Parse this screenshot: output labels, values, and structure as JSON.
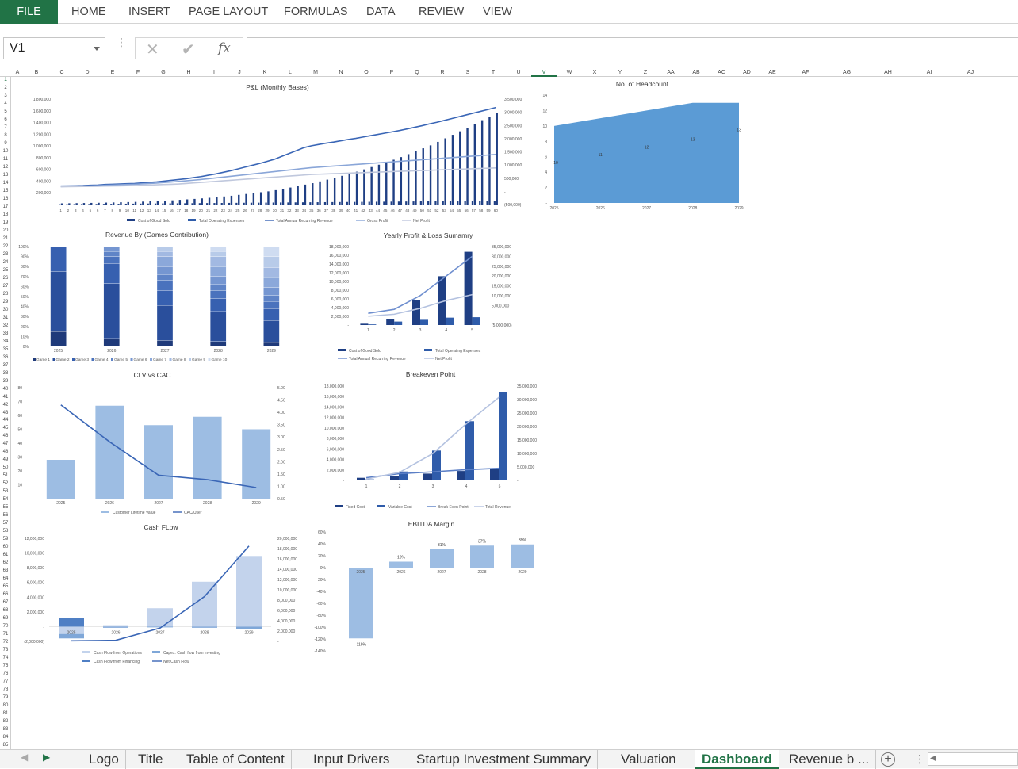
{
  "ribbon": {
    "file": "FILE",
    "tabs": [
      "HOME",
      "INSERT",
      "PAGE LAYOUT",
      "FORMULAS",
      "DATA",
      "REVIEW",
      "VIEW"
    ]
  },
  "formula_bar": {
    "name_box": "V1",
    "formula": "",
    "fx": "fx",
    "cancel": "✕",
    "enter": "✔"
  },
  "columns": [
    "A",
    "B",
    "C",
    "D",
    "E",
    "F",
    "G",
    "H",
    "I",
    "J",
    "K",
    "L",
    "M",
    "N",
    "O",
    "P",
    "Q",
    "R",
    "S",
    "T",
    "U",
    "V",
    "W",
    "X",
    "Y",
    "Z",
    "AA",
    "AB",
    "AC",
    "AD",
    "AE",
    "AF",
    "AG",
    "AH",
    "AI",
    "AJ"
  ],
  "selected_column": "V",
  "rows": [
    1,
    2,
    3,
    4,
    5,
    6,
    7,
    8,
    9,
    10,
    11,
    12,
    13,
    14,
    15,
    16,
    17,
    18,
    19,
    20,
    21,
    22,
    23,
    24,
    25,
    26,
    27,
    28,
    29,
    30,
    31,
    32,
    33,
    34,
    35,
    36,
    37,
    38,
    39,
    40,
    41,
    42,
    43,
    44,
    45,
    46,
    47,
    48,
    49,
    50,
    51,
    52,
    53,
    54,
    55,
    56,
    57,
    58,
    59,
    60,
    61,
    62,
    63,
    64,
    65,
    66,
    67,
    68,
    69,
    70,
    71,
    72,
    73,
    74,
    75,
    76,
    77,
    78,
    79,
    80,
    81,
    82,
    83,
    84,
    85
  ],
  "sheet_tabs": [
    "Logo",
    "Title",
    "Table of Content",
    "Input Drivers",
    "Startup Investment Summary",
    "Valuation",
    "Dashboard",
    "Revenue b ..."
  ],
  "active_sheet": "Dashboard",
  "colors": {
    "excel_green": "#217346",
    "navy": "#1f3f84",
    "mid_blue": "#2f5caa",
    "light_blue": "#9dbde3",
    "pale_blue": "#c3d3ec",
    "area_blue": "#5b9bd5"
  },
  "chart_data": [
    {
      "id": "pnl",
      "type": "bar",
      "title": "P&L (Monthly Bases)",
      "x": [
        1,
        2,
        3,
        4,
        5,
        6,
        7,
        8,
        9,
        10,
        11,
        12,
        13,
        14,
        15,
        16,
        17,
        18,
        19,
        20,
        21,
        22,
        23,
        24,
        25,
        26,
        27,
        28,
        29,
        30,
        31,
        32,
        33,
        34,
        35,
        36,
        37,
        38,
        39,
        40,
        41,
        42,
        43,
        44,
        45,
        46,
        47,
        48,
        49,
        50,
        51,
        52,
        53,
        54,
        55,
        56,
        57,
        58,
        59,
        60
      ],
      "y_left_ticks": [
        "-",
        "200,000",
        "400,000",
        "600,000",
        "800,000",
        "1,000,000",
        "1,200,000",
        "1,400,000",
        "1,600,000",
        "1,800,000"
      ],
      "y_right_ticks": [
        "(500,000)",
        "-",
        "500,000",
        "1,000,000",
        "1,500,000",
        "2,000,000",
        "2,500,000",
        "3,000,000",
        "3,500,000"
      ],
      "ylim_left": [
        0,
        1800000
      ],
      "ylim_right": [
        -500000,
        3500000
      ],
      "series": [
        {
          "name": "Cost of Good Sold",
          "type": "bar",
          "axis": "left",
          "values": [
            5000,
            6000,
            7000,
            8000,
            9000,
            10000,
            11000,
            12000,
            13000,
            14000,
            15000,
            16000,
            17000,
            18000,
            19000,
            20000,
            21000,
            22000,
            23000,
            24000,
            25000,
            26000,
            27000,
            28000,
            29000,
            30000,
            31000,
            32000,
            33000,
            34000,
            35000,
            36000,
            37000,
            38000,
            39000,
            40000,
            41000,
            42000,
            43000,
            44000,
            45000,
            46000,
            47000,
            48000,
            49000,
            50000,
            51000,
            52000,
            53000,
            54000,
            55000,
            56000,
            57000,
            58000,
            59000,
            60000,
            61000,
            62000,
            63000,
            64000
          ]
        },
        {
          "name": "Total Operating Expenses",
          "type": "bar",
          "axis": "left",
          "values": [
            20000,
            22000,
            24000,
            26000,
            28000,
            30000,
            33000,
            36000,
            39000,
            42000,
            45000,
            50000,
            55000,
            60000,
            66000,
            72000,
            80000,
            88000,
            96000,
            105000,
            115000,
            126000,
            138000,
            150000,
            165000,
            180000,
            195000,
            210000,
            225000,
            245000,
            265000,
            290000,
            315000,
            340000,
            365000,
            395000,
            425000,
            455000,
            490000,
            525000,
            560000,
            600000,
            640000,
            680000,
            720000,
            765000,
            810000,
            860000,
            910000,
            960000,
            1010000,
            1070000,
            1130000,
            1190000,
            1250000,
            1310000,
            1380000,
            1440000,
            1500000,
            1560000
          ]
        },
        {
          "name": "Total Annual Recurring Revenue",
          "type": "line",
          "axis": "right",
          "values": [
            200000,
            205000,
            210000,
            215000,
            230000,
            240000,
            260000,
            270000,
            280000,
            290000,
            300000,
            320000,
            340000,
            360000,
            390000,
            420000,
            450000,
            480000,
            520000,
            560000,
            610000,
            660000,
            720000,
            780000,
            850000,
            920000,
            990000,
            1060000,
            1140000,
            1220000,
            1330000,
            1440000,
            1550000,
            1660000,
            1730000,
            1780000,
            1830000,
            1870000,
            1920000,
            1970000,
            2010000,
            2060000,
            2110000,
            2160000,
            2210000,
            2260000,
            2310000,
            2370000,
            2430000,
            2490000,
            2560000,
            2620000,
            2690000,
            2760000,
            2830000,
            2900000,
            2970000,
            3040000,
            3110000,
            3180000
          ]
        },
        {
          "name": "Gross Profit",
          "type": "line",
          "axis": "right",
          "values": [
            180000,
            185000,
            190000,
            195000,
            205000,
            215000,
            230000,
            240000,
            250000,
            260000,
            270000,
            285000,
            300000,
            315000,
            335000,
            355000,
            380000,
            400000,
            425000,
            450000,
            480000,
            510000,
            540000,
            570000,
            600000,
            630000,
            660000,
            690000,
            720000,
            750000,
            780000,
            810000,
            840000,
            870000,
            900000,
            920000,
            940000,
            960000,
            980000,
            1000000,
            1020000,
            1040000,
            1060000,
            1080000,
            1100000,
            1120000,
            1140000,
            1160000,
            1180000,
            1200000,
            1220000,
            1240000,
            1260000,
            1280000,
            1300000,
            1320000,
            1340000,
            1360000,
            1380000,
            1400000
          ]
        },
        {
          "name": "Net Profit",
          "type": "line",
          "axis": "right",
          "values": [
            180000,
            180000,
            182000,
            185000,
            190000,
            195000,
            200000,
            205000,
            210000,
            215000,
            220000,
            230000,
            240000,
            250000,
            260000,
            270000,
            280000,
            300000,
            320000,
            340000,
            360000,
            380000,
            400000,
            420000,
            440000,
            460000,
            480000,
            500000,
            520000,
            540000,
            560000,
            580000,
            600000,
            620000,
            640000,
            650000,
            660000,
            670000,
            680000,
            690000,
            700000,
            710000,
            720000,
            730000,
            740000,
            750000,
            760000,
            770000,
            780000,
            790000,
            800000,
            810000,
            820000,
            830000,
            840000,
            850000,
            860000,
            870000,
            880000,
            890000
          ]
        }
      ]
    },
    {
      "id": "headcount",
      "type": "area",
      "title": "No. of Headcount",
      "categories": [
        "2025",
        "2026",
        "2027",
        "2028",
        "2029"
      ],
      "values": [
        10,
        11,
        12,
        13,
        13
      ],
      "data_labels": [
        "10",
        "11",
        "12",
        "13",
        "13"
      ],
      "y_ticks": [
        "-",
        "2",
        "4",
        "6",
        "8",
        "10",
        "12",
        "14"
      ],
      "ylim": [
        0,
        14
      ]
    },
    {
      "id": "revenue_games",
      "type": "bar",
      "title": "Revenue By (Games Contribution)",
      "categories": [
        "2025",
        "2026",
        "2027",
        "2028",
        "2029"
      ],
      "y_ticks": [
        "0%",
        "10%",
        "20%",
        "30%",
        "40%",
        "50%",
        "60%",
        "70%",
        "80%",
        "90%",
        "100%"
      ],
      "ylim": [
        0,
        1
      ],
      "series": [
        {
          "name": "Game 1",
          "values": [
            0.15,
            0.08,
            0.06,
            0.05,
            0.04
          ]
        },
        {
          "name": "Game 2",
          "values": [
            0.6,
            0.55,
            0.35,
            0.3,
            0.22
          ]
        },
        {
          "name": "Game 3",
          "values": [
            0.25,
            0.2,
            0.15,
            0.13,
            0.12
          ]
        },
        {
          "name": "Game 4",
          "values": [
            0,
            0.07,
            0.1,
            0.08,
            0.07
          ]
        },
        {
          "name": "Game 5",
          "values": [
            0,
            0.05,
            0.06,
            0.06,
            0.06
          ]
        },
        {
          "name": "Game 6",
          "values": [
            0,
            0.05,
            0.08,
            0.08,
            0.08
          ]
        },
        {
          "name": "Game 7",
          "values": [
            0,
            0,
            0.1,
            0.1,
            0.1
          ]
        },
        {
          "name": "Game 8",
          "values": [
            0,
            0,
            0.05,
            0.1,
            0.1
          ]
        },
        {
          "name": "Game 9",
          "values": [
            0,
            0,
            0.05,
            0.05,
            0.11
          ]
        },
        {
          "name": "Game 10",
          "values": [
            0,
            0,
            0,
            0.05,
            0.1
          ]
        }
      ]
    },
    {
      "id": "yearly_pl",
      "type": "bar",
      "title": "Yearly Profit & Loss Sumamry",
      "categories": [
        "1",
        "2",
        "3",
        "4",
        "5"
      ],
      "y_left_ticks": [
        "-",
        "2,000,000",
        "4,000,000",
        "6,000,000",
        "8,000,000",
        "10,000,000",
        "12,000,000",
        "14,000,000",
        "16,000,000",
        "18,000,000"
      ],
      "y_right_ticks": [
        "(5,000,000)",
        "-",
        "5,000,000",
        "10,000,000",
        "15,000,000",
        "20,000,000",
        "25,000,000",
        "30,000,000",
        "35,000,000"
      ],
      "ylim_left": [
        0,
        18000000
      ],
      "ylim_right": [
        -5000000,
        35000000
      ],
      "series": [
        {
          "name": "Cost of Good Sold",
          "type": "bar",
          "axis": "left",
          "values": [
            300000,
            1400000,
            5800000,
            11200000,
            16800000
          ]
        },
        {
          "name": "Total Operating Expenses",
          "type": "bar",
          "axis": "left",
          "values": [
            150000,
            800000,
            1200000,
            1700000,
            1800000
          ]
        },
        {
          "name": "Total Annual Recurring Revenue",
          "type": "line",
          "axis": "right",
          "values": [
            1000000,
            3000000,
            10000000,
            20000000,
            30000000
          ]
        },
        {
          "name": "Net Profit",
          "type": "line",
          "axis": "right",
          "values": [
            -500000,
            500000,
            3500000,
            7500000,
            10500000
          ]
        }
      ]
    },
    {
      "id": "clv_cac",
      "type": "bar",
      "title": "CLV vs CAC",
      "categories": [
        "2025",
        "2026",
        "2027",
        "2028",
        "2029"
      ],
      "y_left_ticks": [
        "-",
        "10",
        "20",
        "30",
        "40",
        "50",
        "60",
        "70",
        "80"
      ],
      "y_right_ticks": [
        "0.50",
        "1.00",
        "1.50",
        "2.00",
        "2.50",
        "3.00",
        "3.50",
        "4.00",
        "4.50",
        "5.00"
      ],
      "ylim_left": [
        0,
        80
      ],
      "ylim_right": [
        0.5,
        5
      ],
      "series": [
        {
          "name": "Customer Lifetime Value",
          "type": "bar",
          "axis": "left",
          "values": [
            28,
            67,
            53,
            59,
            50
          ]
        },
        {
          "name": "CAC/User",
          "type": "line",
          "axis": "right",
          "values": [
            4.3,
            2.8,
            1.45,
            1.27,
            0.95
          ]
        }
      ]
    },
    {
      "id": "breakeven",
      "type": "bar",
      "title": "Breakeven Point",
      "categories": [
        "1",
        "2",
        "3",
        "4",
        "5"
      ],
      "y_left_ticks": [
        "-",
        "2,000,000",
        "4,000,000",
        "6,000,000",
        "8,000,000",
        "10,000,000",
        "12,000,000",
        "14,000,000",
        "16,000,000",
        "18,000,000"
      ],
      "y_right_ticks": [
        "-",
        "5,000,000",
        "10,000,000",
        "15,000,000",
        "20,000,000",
        "25,000,000",
        "30,000,000",
        "35,000,000"
      ],
      "ylim_left": [
        0,
        18000000
      ],
      "ylim_right": [
        0,
        35000000
      ],
      "series": [
        {
          "name": "Fixed Cost",
          "type": "bar",
          "axis": "left",
          "values": [
            500000,
            900000,
            1300000,
            1800000,
            2200000
          ]
        },
        {
          "name": "Variable Cost",
          "type": "bar",
          "axis": "left",
          "values": [
            200000,
            1700000,
            5700000,
            11300000,
            16800000
          ]
        },
        {
          "name": "Break Even Point",
          "type": "line",
          "axis": "right",
          "values": [
            1000000,
            2500000,
            3200000,
            4000000,
            4500000
          ]
        },
        {
          "name": "Total Revenue",
          "type": "line",
          "axis": "right",
          "values": [
            500000,
            3000000,
            10000000,
            21000000,
            31000000
          ]
        }
      ]
    },
    {
      "id": "cashflow",
      "type": "bar",
      "title": "Cash FLow",
      "categories": [
        "2025",
        "2026",
        "2027",
        "2028",
        "2029"
      ],
      "y_left_ticks": [
        "(2,000,000)",
        "-",
        "2,000,000",
        "4,000,000",
        "6,000,000",
        "8,000,000",
        "10,000,000",
        "12,000,000"
      ],
      "y_right_ticks": [
        "-",
        "2,000,000",
        "4,000,000",
        "6,000,000",
        "8,000,000",
        "10,000,000",
        "12,000,000",
        "14,000,000",
        "16,000,000",
        "18,000,000",
        "20,000,000"
      ],
      "ylim_left": [
        -2000000,
        12000000
      ],
      "ylim_right": [
        0,
        20000000
      ],
      "series": [
        {
          "name": "Cash Flow from Operations",
          "type": "bar",
          "axis": "left",
          "values": [
            -1000000,
            200000,
            2500000,
            6100000,
            9600000
          ]
        },
        {
          "name": "Capex: Cash flow from Investing",
          "type": "bar",
          "axis": "left",
          "values": [
            -600000,
            -150000,
            -100000,
            -150000,
            -300000
          ]
        },
        {
          "name": "Cash Flow from Financing",
          "type": "bar",
          "axis": "left",
          "values": [
            1200000,
            0,
            0,
            0,
            0
          ]
        },
        {
          "name": "Net Cash Flow",
          "type": "line",
          "axis": "right",
          "values": [
            100000,
            200000,
            2600000,
            8700000,
            18500000
          ]
        }
      ]
    },
    {
      "id": "ebitda",
      "type": "bar",
      "title": "EBITDA Margin",
      "categories": [
        "2025",
        "2026",
        "2027",
        "2028",
        "2029"
      ],
      "values": [
        -1.19,
        0.1,
        0.31,
        0.37,
        0.39
      ],
      "data_labels": [
        "-119%",
        "10%",
        "31%",
        "37%",
        "39%"
      ],
      "y_ticks": [
        "-140%",
        "-120%",
        "-100%",
        "-80%",
        "-60%",
        "-40%",
        "-20%",
        "0%",
        "20%",
        "40%",
        "60%"
      ],
      "ylim": [
        -1.4,
        0.6
      ]
    }
  ]
}
